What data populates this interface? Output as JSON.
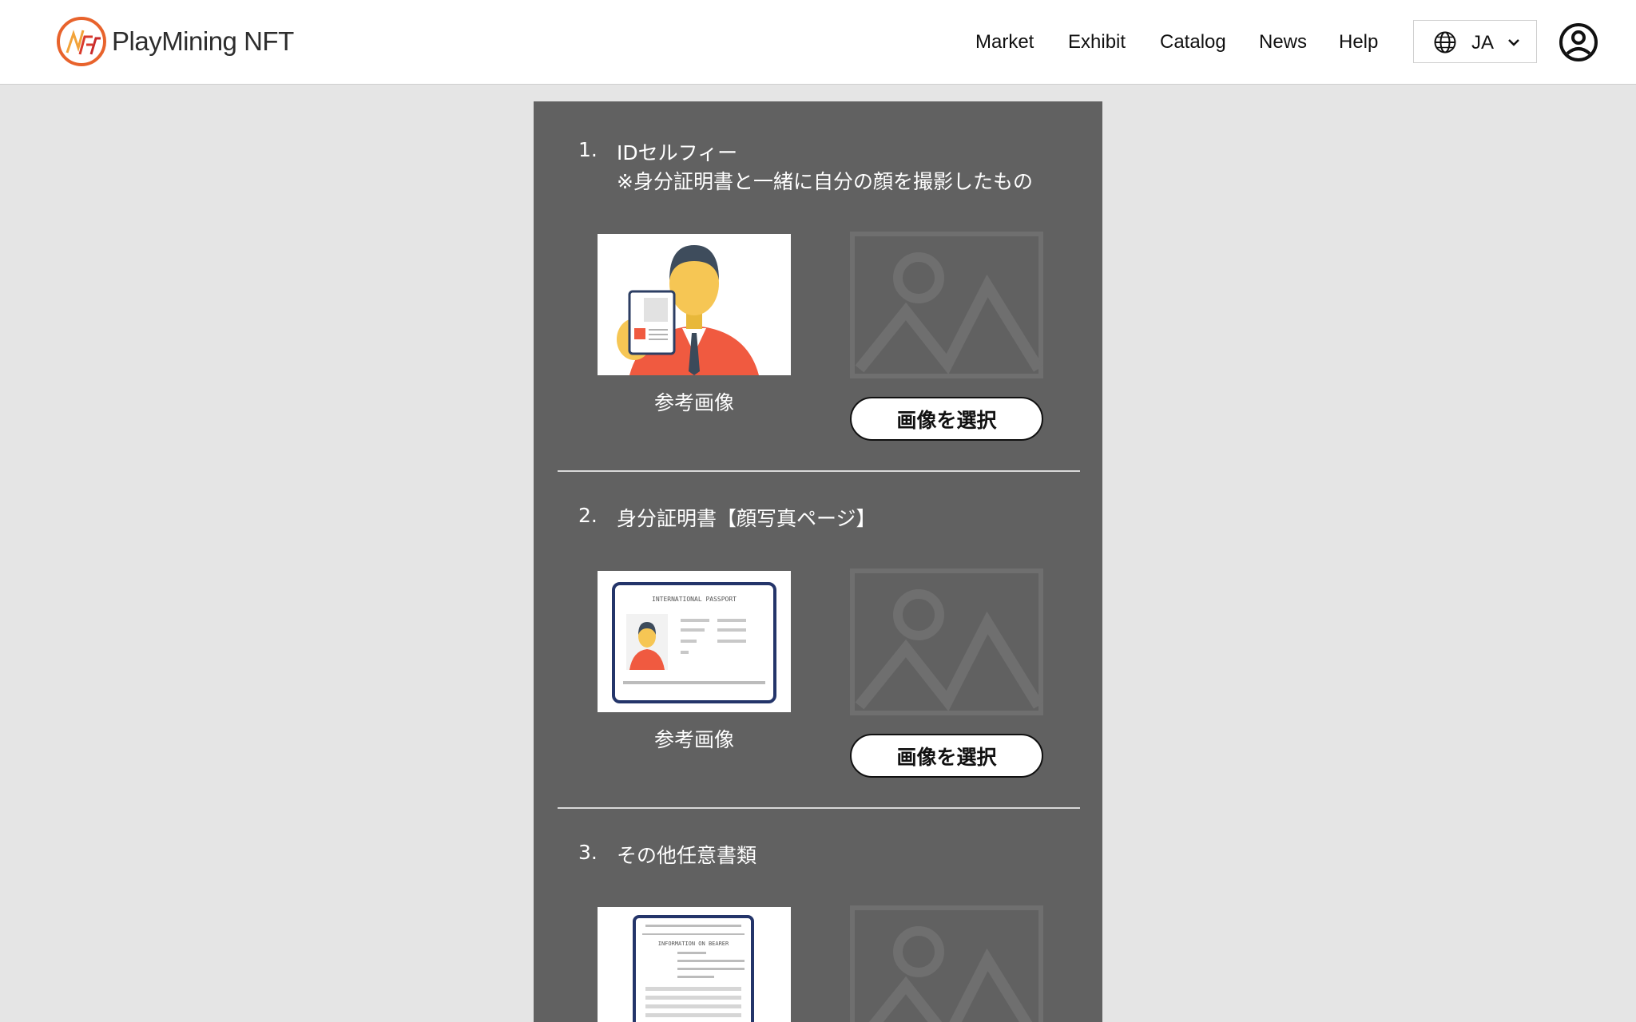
{
  "brand": {
    "name": "PlayMining NFT",
    "accent": "#e8632c"
  },
  "nav": {
    "items": [
      "Market",
      "Exhibit",
      "Catalog",
      "News",
      "Help"
    ]
  },
  "language": {
    "code": "JA",
    "icon": "globe-icon"
  },
  "account": {
    "icon": "account-circle-icon"
  },
  "steps": [
    {
      "number": "1.",
      "title": "IDセルフィー",
      "subtitle": "※身分証明書と一緒に自分の顔を撮影したもの",
      "reference_caption": "参考画像",
      "select_label": "画像を選択"
    },
    {
      "number": "2.",
      "title": "身分証明書【顔写真ページ】",
      "reference_caption": "参考画像",
      "select_label": "画像を選択",
      "passport_header": "INTERNATIONAL PASSPORT"
    },
    {
      "number": "3.",
      "title": "その他任意書類",
      "document_header": "INFORMATION ON BEARER"
    }
  ],
  "colors": {
    "panel": "#616161",
    "background": "#e5e5e5",
    "placeholder": "#6f6f6f"
  }
}
